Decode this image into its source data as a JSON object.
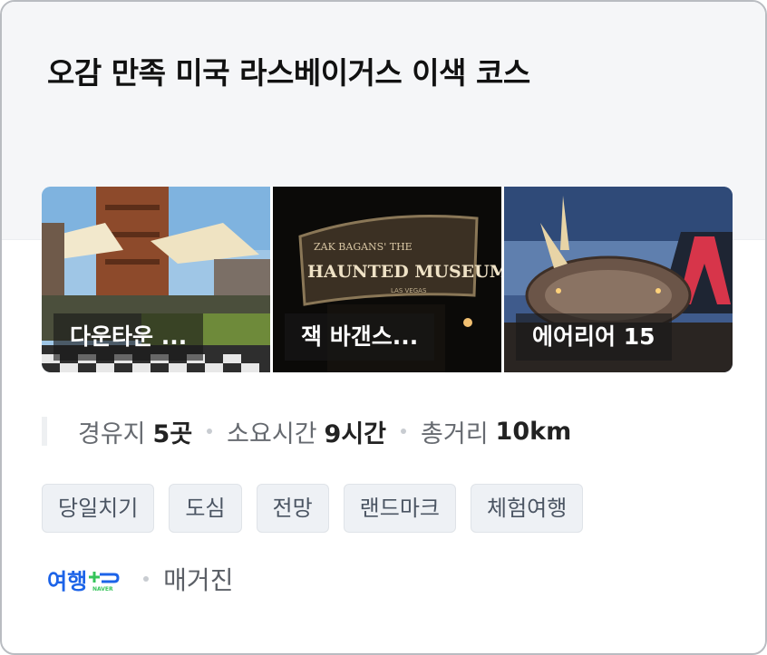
{
  "title": "오감 만족 미국 라스베이거스 이색 코스",
  "thumbnails": [
    {
      "label": "다운타운 ...",
      "image": "downtown-plaza-photo"
    },
    {
      "label": "잭 바갠스...",
      "image": "haunted-museum-sign-photo"
    },
    {
      "label": "에어리어 15",
      "image": "welcome-vegas-sign-photo"
    }
  ],
  "museum_sign": {
    "top": "ZAK BAGANS' THE",
    "main": "HAUNTED MUSEUM",
    "sub": "LAS VEGAS"
  },
  "stats": {
    "stops_label": "경유지",
    "stops_value": "5곳",
    "time_label": "소요시간",
    "time_value": "9시간",
    "distance_label": "총거리",
    "distance_value": "10km"
  },
  "tags": [
    "당일치기",
    "도심",
    "전망",
    "랜드마크",
    "체험여행"
  ],
  "source": {
    "logo_text": "여행",
    "logo_badge": "NAVER",
    "name": "매거진"
  },
  "colors": {
    "accent": "#1c63e8",
    "logo_green": "#35c45a"
  }
}
